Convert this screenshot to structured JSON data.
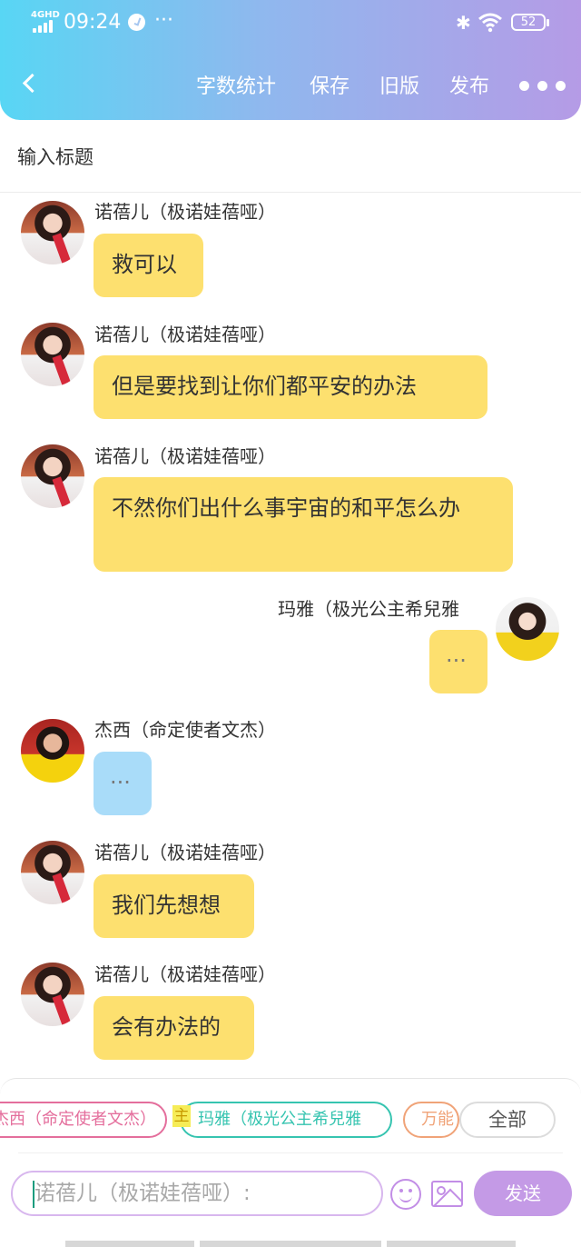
{
  "status_bar": {
    "network": "4GHD",
    "time": "09:24",
    "extra": "···",
    "battery": "52"
  },
  "toolbar": {
    "word_count": "字数统计",
    "save": "保存",
    "old_version": "旧版",
    "publish": "发布"
  },
  "title_placeholder": "输入标题",
  "messages": [
    {
      "speaker": "诺蓓儿（极诺娃蓓哑）",
      "text": "救可以"
    },
    {
      "speaker": "诺蓓儿（极诺娃蓓哑）",
      "text": "但是要找到让你们都平安的办法"
    },
    {
      "speaker": "诺蓓儿（极诺娃蓓哑）",
      "text": "不然你们出什么事宇宙的和平怎么办"
    },
    {
      "speaker": "玛雅（极光公主希兒雅",
      "text": "···"
    },
    {
      "speaker": "杰西（命定使者文杰）",
      "text": "···"
    },
    {
      "speaker": "诺蓓儿（极诺娃蓓哑）",
      "text": "我们先想想"
    },
    {
      "speaker": "诺蓓儿（极诺娃蓓哑）",
      "text": "会有办法的"
    }
  ],
  "role_chips": {
    "chip1": "杰西（命定使者文杰）",
    "main_tag": "主",
    "chip2": "玛雅（极光公主希兒雅",
    "chip3": "万能",
    "all": "全部"
  },
  "composer": {
    "placeholder": "诺蓓儿（极诺娃蓓哑）:",
    "send": "发送"
  },
  "colors": {
    "header_gradient_start": "#58d6f4",
    "header_gradient_end": "#b59be6",
    "bubble_yellow": "#fde06f",
    "bubble_blue": "#a9dcf9",
    "send_button": "#c49ae6"
  }
}
